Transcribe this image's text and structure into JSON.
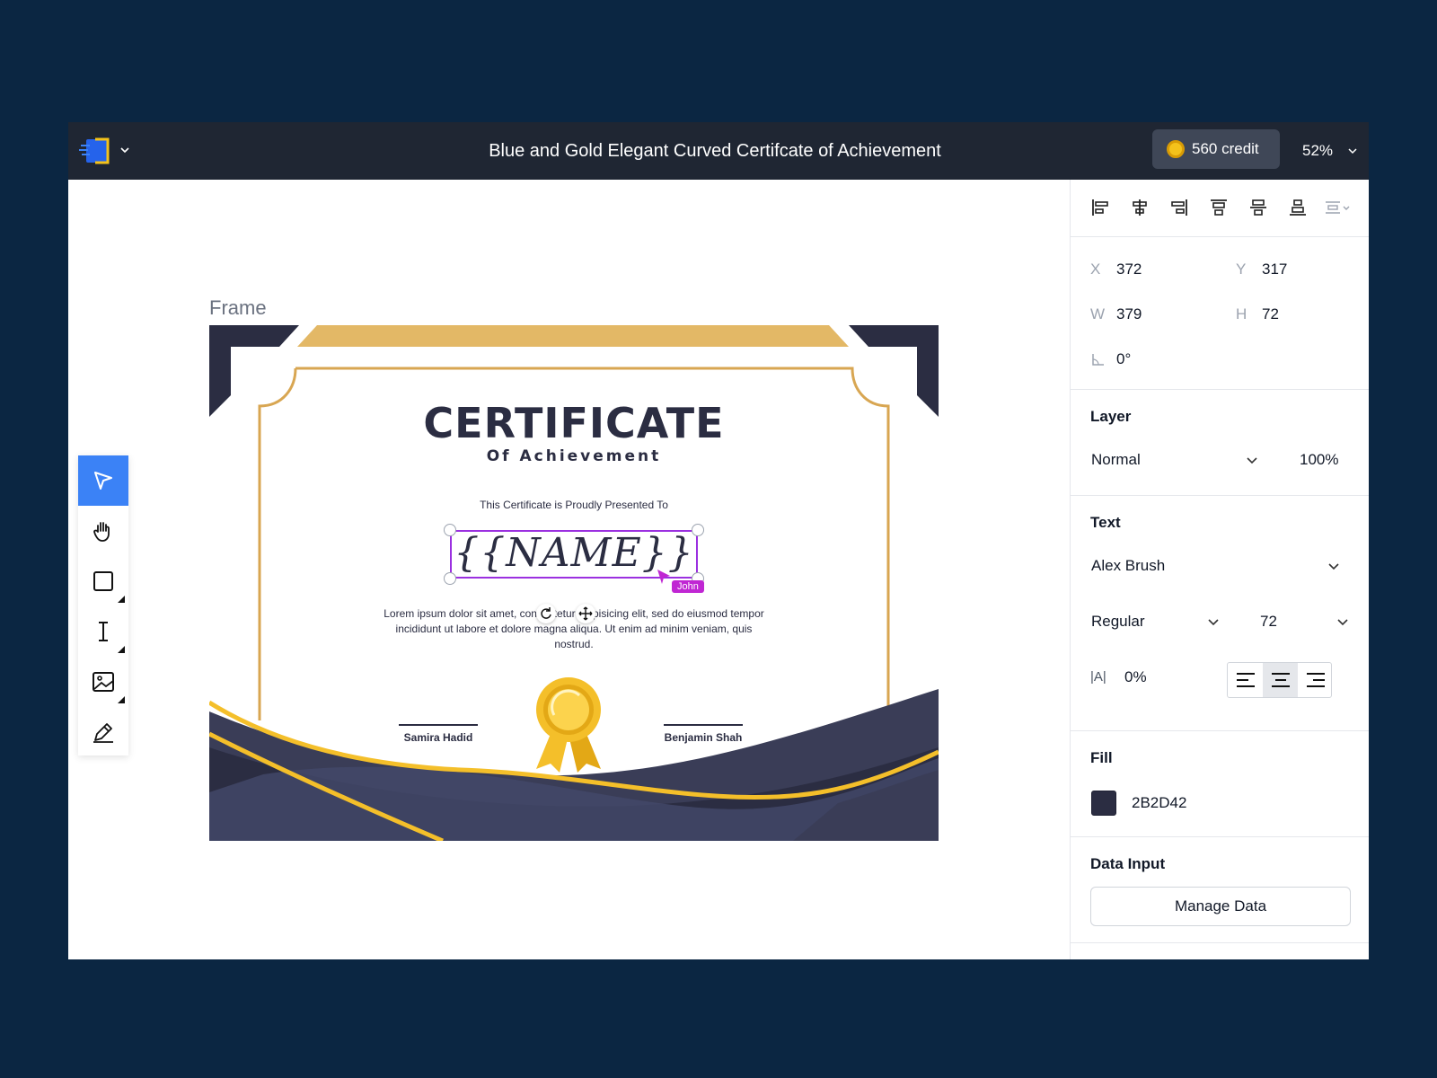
{
  "header": {
    "title": "Blue and Gold Elegant Curved Certifcate of Achievement",
    "credit": "560 credit",
    "zoom": "52%"
  },
  "canvas": {
    "frame_label": "Frame",
    "certificate": {
      "title": "CERTIFICATE",
      "subtitle": "Of Achievement",
      "presented": "This Certificate is Proudly Presented To",
      "name": "{{NAME}}",
      "body": "Lorem ipsum dolor sit amet, consectetur adipisicing elit, sed do eiusmod tempor incididunt ut labore et dolore magna aliqua. Ut enim ad minim veniam, quis nostrud.",
      "signer_left": "Samira Hadid",
      "signer_right": "Benjamin Shah"
    },
    "collaborator_tag": "John"
  },
  "toolbar": {
    "tools": [
      "select-tool",
      "hand-tool",
      "shape-tool",
      "text-tool",
      "image-tool",
      "pen-tool"
    ],
    "active": "select-tool"
  },
  "panel": {
    "position": {
      "x_label": "X",
      "x": "372",
      "y_label": "Y",
      "y": "317",
      "w_label": "W",
      "w": "379",
      "h_label": "H",
      "h": "72",
      "rotation": "0°"
    },
    "layer": {
      "title": "Layer",
      "blend": "Normal",
      "opacity": "100%"
    },
    "text": {
      "title": "Text",
      "font": "Alex Brush",
      "weight": "Regular",
      "size": "72",
      "letter_spacing_icon": "|A|",
      "letter_spacing": "0%",
      "alignment": "center"
    },
    "fill": {
      "title": "Fill",
      "hex": "2B2D42",
      "color": "#2B2D42"
    },
    "data_input": {
      "title": "Data Input",
      "button": "Manage Data"
    }
  },
  "colors": {
    "background": "#0b2642",
    "topbar": "#1f2633",
    "accent": "#3b82f6",
    "gold": "#e3b866",
    "navy": "#2b2d42",
    "selection": "#9b30e0"
  }
}
